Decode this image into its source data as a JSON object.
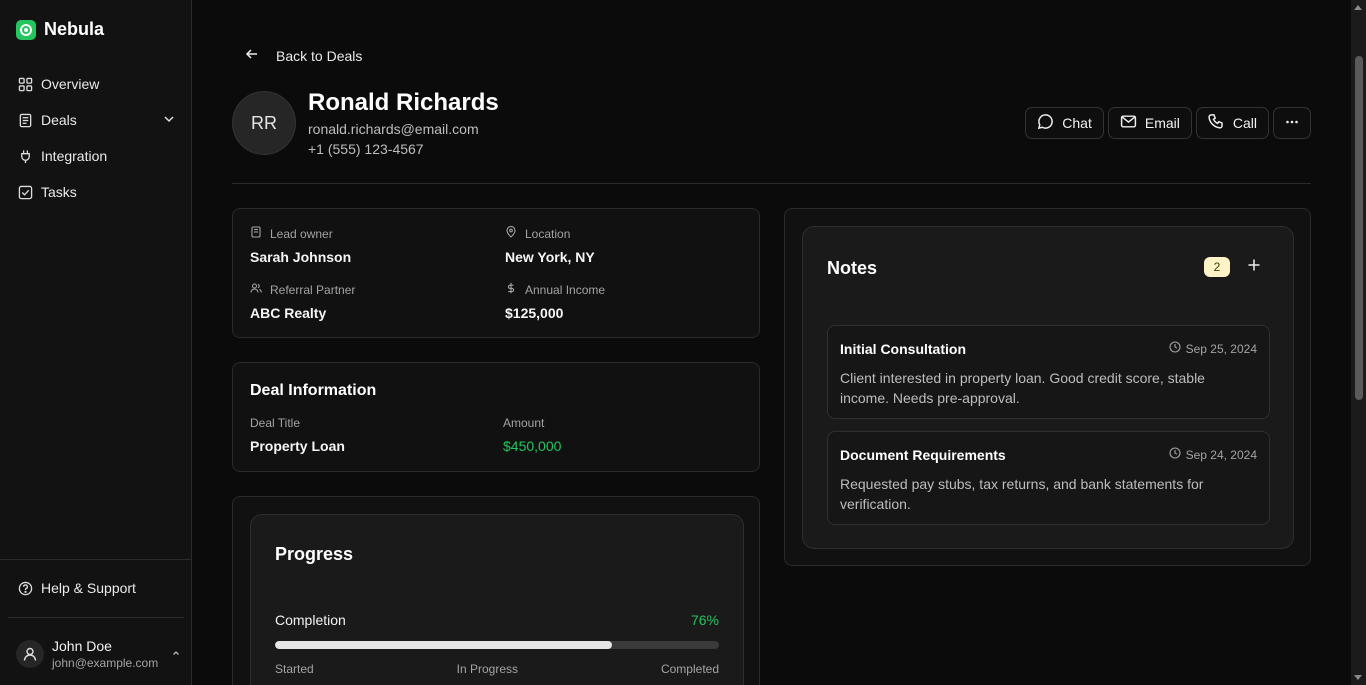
{
  "app": {
    "name": "Nebula",
    "accent": "#22c55e"
  },
  "sidebar": {
    "items": [
      {
        "label": "Overview",
        "icon": "grid-icon"
      },
      {
        "label": "Deals",
        "icon": "clipboard-icon"
      },
      {
        "label": "Integration",
        "icon": "plug-icon"
      },
      {
        "label": "Tasks",
        "icon": "checkbox-icon"
      }
    ],
    "help": {
      "label": "Help & Support",
      "icon": "help-circle-icon"
    },
    "user": {
      "name": "John Doe",
      "email": "john@example.com"
    }
  },
  "header": {
    "back_label": "Back to Deals",
    "initials": "RR",
    "name": "Ronald Richards",
    "email": "ronald.richards@email.com",
    "phone": "+1 (555) 123-4567",
    "actions": {
      "chat": "Chat",
      "email": "Email",
      "call": "Call"
    }
  },
  "info": {
    "lead_owner": {
      "label": "Lead owner",
      "value": "Sarah Johnson"
    },
    "location": {
      "label": "Location",
      "value": "New York, NY"
    },
    "referral": {
      "label": "Referral Partner",
      "value": "ABC Realty"
    },
    "income": {
      "label": "Annual Income",
      "value": "$125,000"
    }
  },
  "deal": {
    "title": "Deal Information",
    "deal_title_label": "Deal Title",
    "deal_title_value": "Property Loan",
    "amount_label": "Amount",
    "amount_value": "$450,000"
  },
  "progress": {
    "title": "Progress",
    "label": "Completion",
    "percent_text": "76%",
    "value": 0.76,
    "stages": [
      "Started",
      "In Progress",
      "Completed"
    ]
  },
  "notes": {
    "title": "Notes",
    "count": "2",
    "items": [
      {
        "title": "Initial Consultation",
        "date": "Sep 25, 2024",
        "body": "Client interested in property loan. Good credit score, stable income. Needs pre-approval."
      },
      {
        "title": "Document Requirements",
        "date": "Sep 24, 2024",
        "body": "Requested pay stubs, tax returns, and bank statements for verification."
      }
    ]
  }
}
